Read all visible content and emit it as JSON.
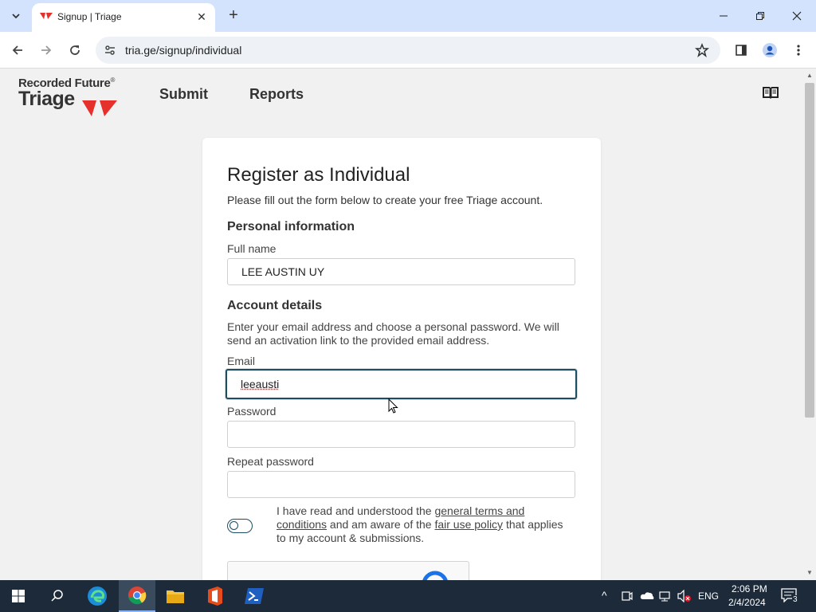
{
  "browser": {
    "tab_title": "Signup | Triage",
    "url": "tria.ge/signup/individual"
  },
  "site": {
    "logo_top": "Recorded Future",
    "logo_registered": "®",
    "logo_bottom": "Triage",
    "nav": {
      "submit": "Submit",
      "reports": "Reports"
    }
  },
  "form": {
    "title": "Register as Individual",
    "subtitle": "Please fill out the form below to create your free Triage account.",
    "personal_section": "Personal information",
    "full_name_label": "Full name",
    "full_name_value": "LEE AUSTIN UY",
    "account_section": "Account details",
    "account_desc": "Enter your email address and choose a personal password. We will send an activation link to the provided email address.",
    "email_label": "Email",
    "email_value": "leeausti",
    "password_label": "Password",
    "password_value": "",
    "repeat_label": "Repeat password",
    "repeat_value": "",
    "terms_prefix": "I have read and understood the ",
    "terms_link": "general terms and conditions",
    "terms_middle": " and am aware of the ",
    "fair_use_link": "fair use policy",
    "terms_suffix": " that applies to my account & submissions.",
    "terms_accepted": false
  },
  "taskbar": {
    "language": "ENG",
    "time": "2:06 PM",
    "date": "2/4/2024",
    "notification_count": "3"
  },
  "colors": {
    "accent": "#1c4e63",
    "brand_red": "#e5302b",
    "tab_strip": "#d3e3fd"
  }
}
